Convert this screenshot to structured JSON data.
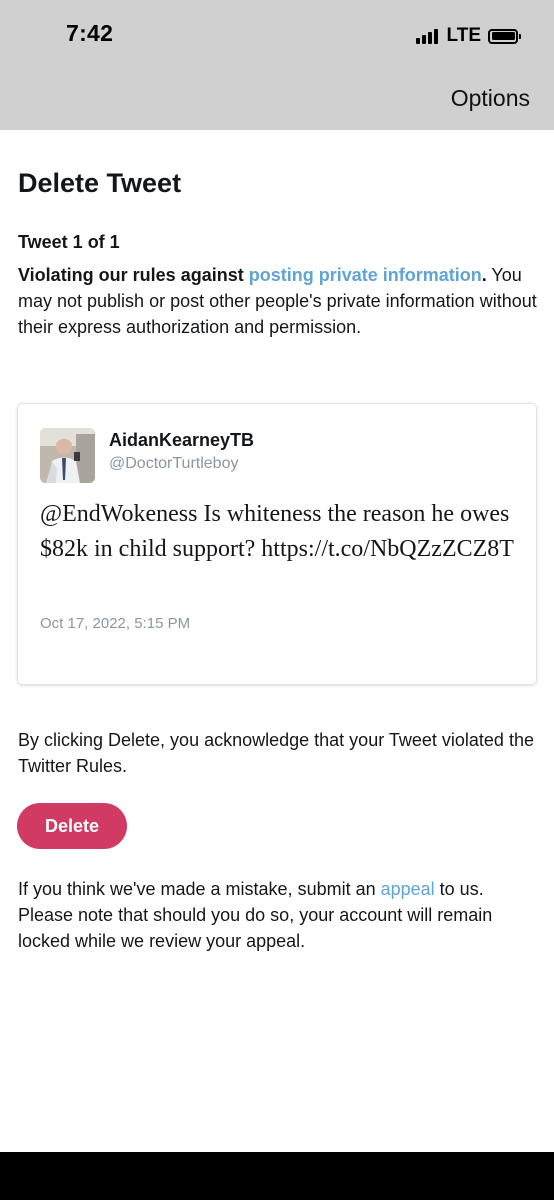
{
  "status_bar": {
    "time": "7:42",
    "network": "LTE",
    "signal_bars": 4,
    "battery_level": 1.0
  },
  "header": {
    "options_label": "Options"
  },
  "page": {
    "title": "Delete Tweet",
    "counter": "Tweet 1 of 1",
    "violation_prefix": "Violating our rules against ",
    "violation_link": "posting private information",
    "violation_suffix": ".",
    "violation_detail": " You may not publish or post other people's private information without their express authorization and permission."
  },
  "tweet": {
    "display_name": "AidanKearneyTB",
    "handle": "@DoctorTurtleboy",
    "text": "@EndWokeness Is whiteness the reason he owes $82k in child support? https://t.co/NbQZzZCZ8T",
    "timestamp": "Oct 17, 2022, 5:15 PM"
  },
  "acknowledgement": "By clicking Delete, you acknowledge that your Tweet violated the Twitter Rules.",
  "delete_label": "Delete",
  "appeal": {
    "prefix": "If you think we've made a mistake, submit an ",
    "link": "appeal",
    "suffix": " to us. Please note that should you do so, your account will remain locked while we review your appeal."
  },
  "colors": {
    "header_bg": "#d0d0d0",
    "link": "#5fa3d9",
    "delete_button": "#d13a62",
    "muted_text": "#8a96a3"
  }
}
